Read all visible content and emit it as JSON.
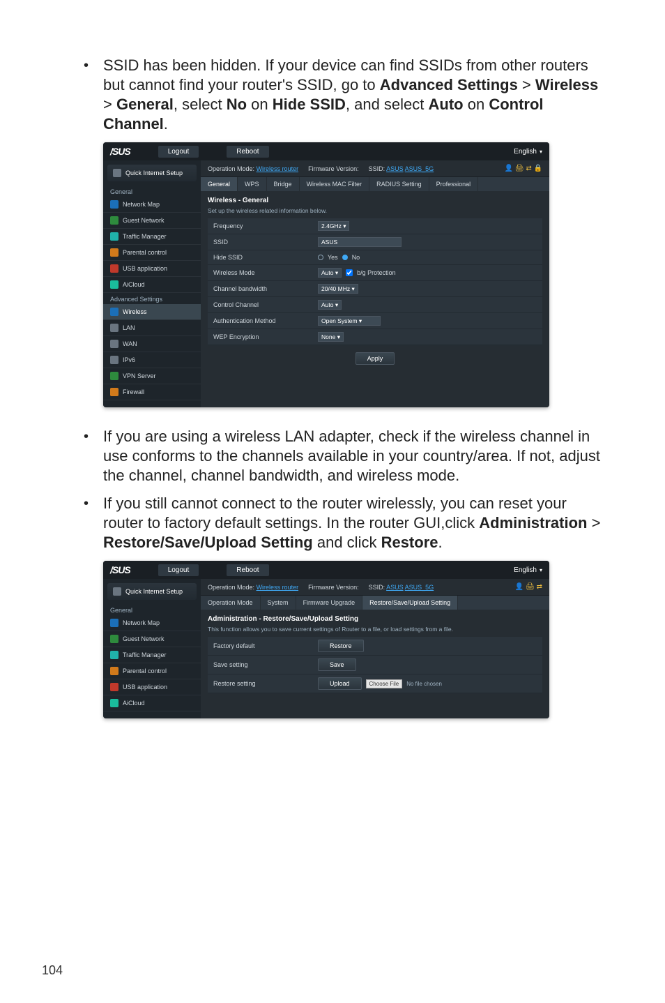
{
  "page_number": "104",
  "bullets": {
    "b1_pre": "SSID has been hidden. If your device can find SSIDs from other routers but cannot find your router's SSID, go to ",
    "b1_adv": "Advanced Settings",
    "b1_gt1": " > ",
    "b1_wireless": "Wireless",
    "b1_gt2": " > ",
    "b1_general": "General",
    "b1_mid": ", select ",
    "b1_no": "No",
    "b1_on1": " on ",
    "b1_hide": "Hide SSID",
    "b1_and": ", and select ",
    "b1_auto": "Auto",
    "b1_on2": " on ",
    "b1_cc": "Control Channel",
    "b1_end": ".",
    "b2": "If you are using a wireless LAN adapter, check if the wireless channel in use conforms to the channels available in your country/area. If not, adjust the channel, channel bandwidth, and wireless mode.",
    "b3_pre": "If you still cannot connect to the router wirelessly, you can reset your router to factory default settings. In the router GUI,click ",
    "b3_admin": "Administration",
    "b3_gt": " > ",
    "b3_rsu": "Restore/Save/Upload Setting",
    "b3_and": " and click ",
    "b3_restore": "Restore",
    "b3_end": "."
  },
  "ui": {
    "logo": "/SUS",
    "logout": "Logout",
    "reboot": "Reboot",
    "english": "English",
    "op_mode_label": "Operation Mode:",
    "op_mode_value": "Wireless router",
    "fw_label": "Firmware Version:",
    "ssid_label": "SSID:",
    "ssid_24": "ASUS",
    "ssid_5": "ASUS_5G",
    "qis": "Quick Internet Setup",
    "section_general": "General",
    "section_advanced": "Advanced Settings"
  },
  "sidebar1": [
    {
      "label": "Network Map",
      "icon": "ic-blue"
    },
    {
      "label": "Guest Network",
      "icon": "ic-green"
    },
    {
      "label": "Traffic Manager",
      "icon": "ic-cyan"
    },
    {
      "label": "Parental control",
      "icon": "ic-orange"
    },
    {
      "label": "USB application",
      "icon": "ic-red"
    },
    {
      "label": "AiCloud",
      "icon": "ic-teal"
    }
  ],
  "sidebar1_adv": [
    {
      "label": "Wireless",
      "icon": "ic-blue",
      "active": true
    },
    {
      "label": "LAN",
      "icon": "ic-gray"
    },
    {
      "label": "WAN",
      "icon": "ic-gray"
    },
    {
      "label": "IPv6",
      "icon": "ic-gray"
    },
    {
      "label": "VPN Server",
      "icon": "ic-green"
    },
    {
      "label": "Firewall",
      "icon": "ic-orange"
    }
  ],
  "tabs1": [
    "General",
    "WPS",
    "Bridge",
    "Wireless MAC Filter",
    "RADIUS Setting",
    "Professional"
  ],
  "panel1": {
    "title": "Wireless - General",
    "sub": "Set up the wireless related information below.",
    "rows": {
      "frequency": {
        "label": "Frequency",
        "value": "2.4GHz"
      },
      "ssid": {
        "label": "SSID",
        "value": "ASUS"
      },
      "hide": {
        "label": "Hide SSID",
        "yes": "Yes",
        "no": "No"
      },
      "mode": {
        "label": "Wireless Mode",
        "value": "Auto",
        "bg": "b/g Protection"
      },
      "bw": {
        "label": "Channel bandwidth",
        "value": "20/40 MHz"
      },
      "ch": {
        "label": "Control Channel",
        "value": "Auto"
      },
      "auth": {
        "label": "Authentication Method",
        "value": "Open System"
      },
      "wep": {
        "label": "WEP Encryption",
        "value": "None"
      }
    },
    "apply": "Apply"
  },
  "sidebar2": [
    {
      "label": "Network Map",
      "icon": "ic-blue"
    },
    {
      "label": "Guest Network",
      "icon": "ic-green"
    },
    {
      "label": "Traffic Manager",
      "icon": "ic-cyan"
    },
    {
      "label": "Parental control",
      "icon": "ic-orange"
    },
    {
      "label": "USB application",
      "icon": "ic-red"
    },
    {
      "label": "AiCloud",
      "icon": "ic-teal"
    }
  ],
  "tabs2": [
    "Operation Mode",
    "System",
    "Firmware Upgrade",
    "Restore/Save/Upload Setting"
  ],
  "panel2": {
    "title": "Administration - Restore/Save/Upload Setting",
    "sub": "This function allows you to save current settings of Router to a file, or load settings from a file.",
    "rows": {
      "factory": {
        "label": "Factory default",
        "btn": "Restore"
      },
      "save": {
        "label": "Save setting",
        "btn": "Save"
      },
      "restore": {
        "label": "Restore setting",
        "btn": "Upload",
        "choose": "Choose File",
        "nofile": "No file chosen"
      }
    }
  }
}
